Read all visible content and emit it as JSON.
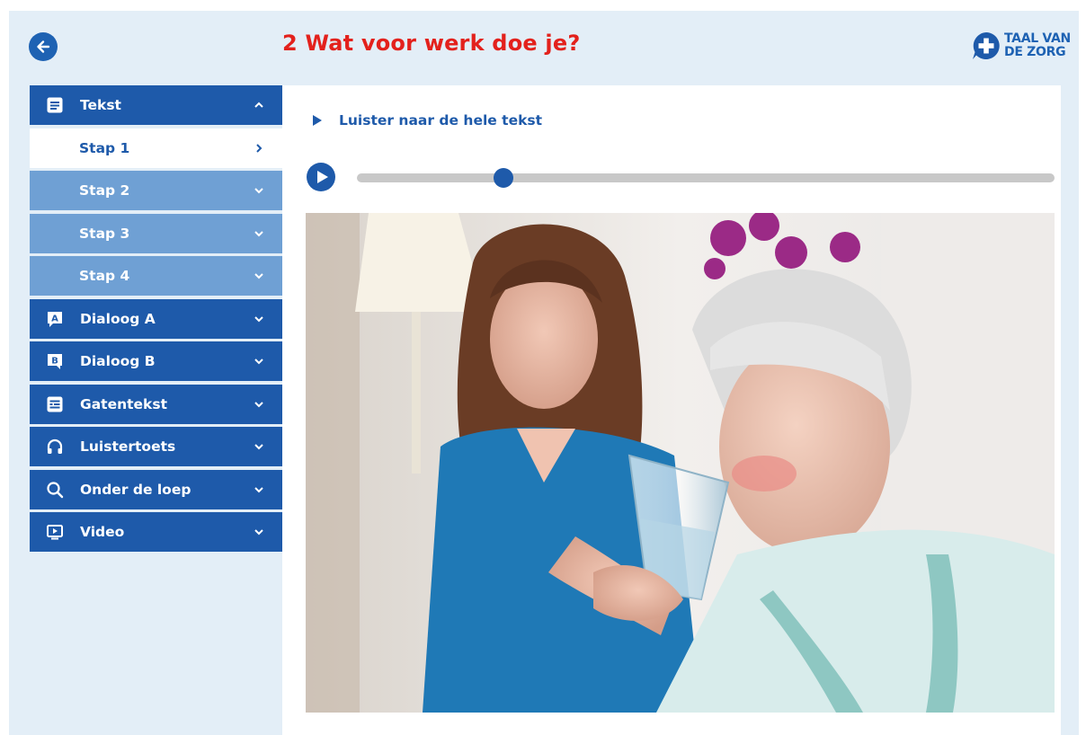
{
  "header": {
    "title": "2  Wat voor werk doe je?",
    "back_icon": "arrow-left-icon",
    "logo": {
      "line1": "TAAL VAN",
      "line2": "DE ZORG",
      "icon": "plus-speech-bubble-icon"
    }
  },
  "sidebar": {
    "items": [
      {
        "label": "Tekst",
        "icon": "document-icon",
        "chevron": "chevron-up-icon",
        "state": "expanded"
      },
      {
        "label": "Stap 1",
        "chevron": "chevron-right-icon",
        "state": "active"
      },
      {
        "label": "Stap 2",
        "chevron": "chevron-down-icon",
        "state": "sub"
      },
      {
        "label": "Stap 3",
        "chevron": "chevron-down-icon",
        "state": "sub"
      },
      {
        "label": "Stap 4",
        "chevron": "chevron-down-icon",
        "state": "sub"
      },
      {
        "label": "Dialoog A",
        "icon": "dialog-a-icon",
        "chevron": "chevron-down-icon"
      },
      {
        "label": "Dialoog B",
        "icon": "dialog-b-icon",
        "chevron": "chevron-down-icon"
      },
      {
        "label": "Gatentekst",
        "icon": "fill-in-text-icon",
        "chevron": "chevron-down-icon"
      },
      {
        "label": "Luistertoets",
        "icon": "headphones-icon",
        "chevron": "chevron-down-icon"
      },
      {
        "label": "Onder de loep",
        "icon": "magnifier-icon",
        "chevron": "chevron-down-icon"
      },
      {
        "label": "Video",
        "icon": "video-icon",
        "chevron": "chevron-down-icon"
      }
    ]
  },
  "main": {
    "listen_label": "Luister naar de hele tekst",
    "audio": {
      "progress": 0.21
    },
    "photo": {
      "alt": "Verzorgende helpt oudere vrouw met drinken uit een glas water"
    }
  },
  "colors": {
    "primary": "#1e5aaa",
    "sub_item": "#6fa0d4",
    "title_red": "#e3211c",
    "background": "#e3eef7"
  }
}
